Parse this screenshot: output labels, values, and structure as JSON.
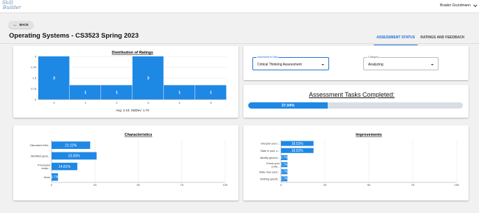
{
  "app": {
    "logo_line1": "Skill",
    "logo_line2": "Builder",
    "user_name": "Braden Grundmann"
  },
  "back_label": "BACK",
  "page_title": "Operating Systems - CS3523  Spring  2023",
  "tabs": [
    {
      "label": "ASSESSMENT STATUS",
      "active": true
    },
    {
      "label": "RATINGS AND FEEDBACK",
      "active": false
    }
  ],
  "colors": {
    "accent": "#1e6fd9",
    "bar": "#1e88e5"
  },
  "filters": {
    "task": {
      "label": "Assessment Task",
      "value": "Critical Thinking Assessment"
    },
    "category": {
      "label": "Category",
      "value": "Analyzing"
    }
  },
  "completed": {
    "title": "Assessment Tasks Completed:",
    "value_label": "37.04%",
    "value": 37.04
  },
  "chart_data": [
    {
      "type": "bar",
      "title": "Distribution of Ratings",
      "categories": [
        "0",
        "1",
        "2",
        "3",
        "4",
        "5"
      ],
      "values": [
        3,
        1,
        1,
        3,
        1,
        1
      ],
      "data_labels": [
        "3",
        "1",
        "1",
        "3",
        "1",
        "1"
      ],
      "yticks": [
        "0",
        "0.75",
        "1.5",
        "2.25",
        "3"
      ],
      "ylim": [
        0,
        3
      ],
      "footer": "Avg: 2.10; StdDev: 1.70",
      "grid": true
    },
    {
      "type": "bar",
      "orientation": "horizontal",
      "title": "Characteristics",
      "categories": [
        "Discussed infor...",
        "Identified gene...",
        "Processed\nandjo...",
        "None"
      ],
      "values": [
        22.22,
        25.93,
        14.81,
        3.7
      ],
      "data_labels": [
        "22.22%",
        "25.93%",
        "14.81%",
        "3.7%"
      ],
      "xticks": [
        "0",
        "25",
        "50",
        "75",
        "100"
      ],
      "xlim": [
        0,
        100
      ],
      "grid": true
    },
    {
      "type": "bar",
      "orientation": "horizontal",
      "title": "Improvements",
      "categories": [
        "Interpret and I...",
        "State in your o...",
        "Identify genera...",
        "Check your\nunde...",
        "State how each...",
        "Nothing specifi..."
      ],
      "values": [
        18.52,
        18.52,
        3.7,
        3.7,
        3.7,
        3.7
      ],
      "data_labels": [
        "18.52%",
        "18.52%",
        "3.7%",
        "3.7%",
        "3.7%",
        "3.7%"
      ],
      "xticks": [
        "0",
        "25",
        "50",
        "75",
        "100"
      ],
      "xlim": [
        0,
        100
      ],
      "grid": true
    }
  ]
}
